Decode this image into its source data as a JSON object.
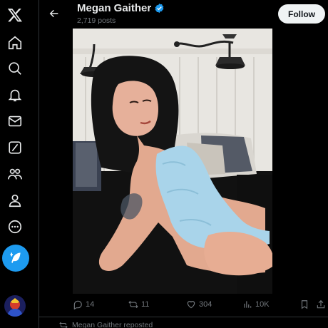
{
  "sidebar": {
    "items": [
      {
        "icon": "x-logo-icon"
      },
      {
        "icon": "home-icon"
      },
      {
        "icon": "explore-icon"
      },
      {
        "icon": "notifications-icon"
      },
      {
        "icon": "messages-icon"
      },
      {
        "icon": "grok-icon"
      },
      {
        "icon": "communities-icon"
      },
      {
        "icon": "profile-icon"
      },
      {
        "icon": "more-icon"
      }
    ],
    "post_button_icon": "compose-feather-icon"
  },
  "header": {
    "display_name": "Megan Gaither",
    "verified": true,
    "post_count": "2,719 posts",
    "follow_label": "Follow"
  },
  "actions": {
    "replies": "14",
    "reposts": "11",
    "likes": "304",
    "views": "10K"
  },
  "next_item": {
    "repost_text": "Megan Gaither reposted"
  },
  "colors": {
    "accent": "#1d9bf0",
    "background": "#000000",
    "text": "#e7e9ea",
    "muted": "#71767b",
    "border": "#2f3336"
  }
}
